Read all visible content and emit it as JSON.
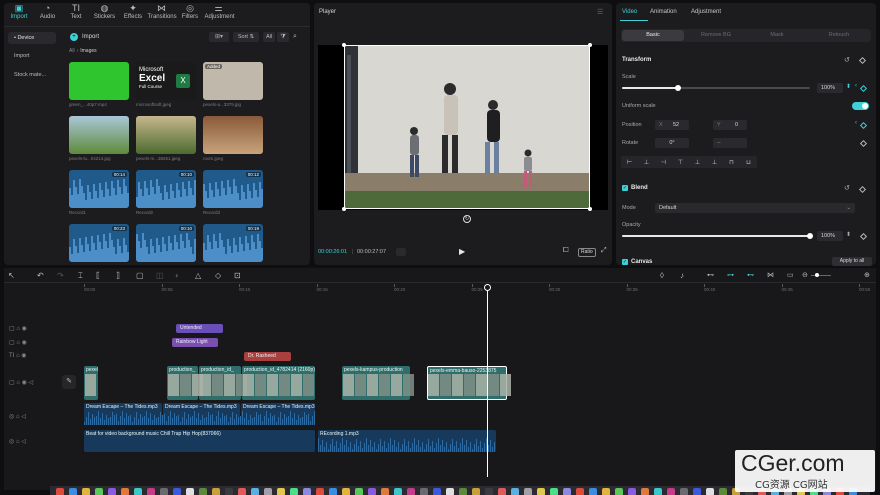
{
  "toolbar": {
    "tools": [
      {
        "label": "Import",
        "icon": "import-icon",
        "glyph": "▣"
      },
      {
        "label": "Audio",
        "icon": "audio-icon",
        "glyph": "◔"
      },
      {
        "label": "Text",
        "icon": "text-icon",
        "glyph": "TI"
      },
      {
        "label": "Stickers",
        "icon": "sticker-icon",
        "glyph": "◍"
      },
      {
        "label": "Effects",
        "icon": "effects-icon",
        "glyph": "✦"
      },
      {
        "label": "Transitions",
        "icon": "transitions-icon",
        "glyph": "⋈"
      },
      {
        "label": "Filters",
        "icon": "filters-icon",
        "glyph": "◎"
      },
      {
        "label": "Adjustment",
        "icon": "adjustment-icon",
        "glyph": "⚌"
      }
    ]
  },
  "media": {
    "sidebar": [
      "• Device",
      "Import",
      "Stock mate..."
    ],
    "import_label": "Import",
    "breadcrumb_root": "All",
    "breadcrumb_folder": "Images",
    "sort_label": "Sort",
    "filter_label": "All",
    "thumbs": [
      {
        "caption": "green_...40p7.mp4",
        "badge": ""
      },
      {
        "caption": "microsoftsoft.jpeg",
        "badge": ""
      },
      {
        "caption": "pexels-a...3379.jpg",
        "badge": "Added"
      },
      {
        "caption": "pexels-lu...04214.jpg",
        "badge": ""
      },
      {
        "caption": "pexels-m...38261.jpeg",
        "badge": ""
      },
      {
        "caption": "room.jpeg",
        "badge": ""
      },
      {
        "caption": "Record1",
        "badge": "00:14"
      },
      {
        "caption": "Record2",
        "badge": "00:10"
      },
      {
        "caption": "Record3",
        "badge": "00:12"
      },
      {
        "caption": "",
        "badge": "00:23"
      },
      {
        "caption": "",
        "badge": "00:10"
      },
      {
        "caption": "",
        "badge": "00:19"
      }
    ],
    "excel_title": "Microsoft",
    "excel_word": "Excel",
    "excel_sub": "Full Course"
  },
  "player": {
    "title": "Player",
    "current_time": "00:00:26:01",
    "total_time": "00:00:27:07",
    "ratio_label": "Ratio"
  },
  "inspector": {
    "tabs": [
      "Video",
      "Animation",
      "Adjustment"
    ],
    "subtabs": [
      "Basic",
      "Remove BG",
      "Mask",
      "Retouch"
    ],
    "transform_title": "Transform",
    "scale_label": "Scale",
    "scale_value": "100%",
    "scale_fraction": 0.3,
    "uniform_scale_label": "Uniform scale",
    "position_label": "Position",
    "pos_x_label": "X",
    "pos_x_value": "52",
    "pos_y_label": "Y",
    "pos_y_value": "0",
    "rotate_label": "Rotate",
    "rotate_value": "0°",
    "rotate_dash": "--",
    "blend_title": "Blend",
    "mode_label": "Mode",
    "mode_value": "Default",
    "opacity_label": "Opacity",
    "opacity_value": "100%",
    "opacity_fraction": 1.0,
    "canvas_title": "Canvas",
    "apply_all": "Apply to all",
    "accent": "#3ed0d6"
  },
  "timeline": {
    "ruler": [
      "00:00",
      "00:05",
      "00:10",
      "00:15",
      "00:20",
      "00:25",
      "00:30",
      "00:35",
      "00:40",
      "00:45",
      "00:50"
    ],
    "text_chips": [
      {
        "label": "Untended",
        "color": "#6a4fb8"
      },
      {
        "label": "Rainbow Light",
        "color": "#7a4fb0"
      },
      {
        "label": "Dr. Rasheed",
        "color": "#a8403f"
      }
    ],
    "video_clips": [
      "pexels",
      "production_",
      "production_id_",
      "production_id_4782414 (2160p)",
      "pexels-kampus-production",
      "pexels-emma-bauso-2253875"
    ],
    "audio1": [
      "Dream Escape – The Tides.mp3",
      "Dream Escape – The Tides.mp3",
      "Dream Escape – The Tides.mp3"
    ],
    "audio2": [
      "Beat for video background music Chill Trap Hip Hop(837066)",
      "REcording 1.mp3"
    ]
  },
  "watermark": {
    "brand": "CGer.com",
    "sub": "CG资源 CG网站"
  }
}
